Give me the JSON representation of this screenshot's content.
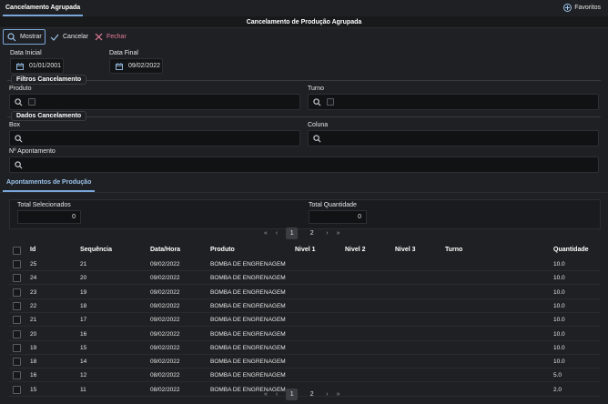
{
  "tab": {
    "label": "Cancelamento Agrupada"
  },
  "favorites": {
    "label": "Favoritos"
  },
  "page": {
    "title": "Cancelamento de Produção Agrupada"
  },
  "toolbar": {
    "mostrar": "Mostrar",
    "cancelar": "Cancelar",
    "fechar": "Fechar"
  },
  "dates": {
    "start_label": "Data Inicial",
    "start_value": "01/01/2001",
    "end_label": "Data Final",
    "end_value": "09/02/2022"
  },
  "filters": {
    "title": "Filtros Cancelamento",
    "produto_label": "Produto",
    "turno_label": "Turno"
  },
  "dados": {
    "title": "Dados Cancelamento",
    "box_label": "Box",
    "coluna_label": "Coluna",
    "apontamento_label": "Nº Apontamento"
  },
  "subtab": {
    "label": "Apontamentos de Produção"
  },
  "totals": {
    "selecionados_label": "Total Selecionados",
    "selecionados_value": "0",
    "quantidade_label": "Total Quantidade",
    "quantidade_value": "0"
  },
  "pager": {
    "first": "«",
    "prev": "‹",
    "pages": [
      "1",
      "2"
    ],
    "next": "›",
    "last": "»",
    "active_page": "1"
  },
  "table": {
    "columns": [
      "Id",
      "Sequência",
      "Data/Hora",
      "Produto",
      "Nivel 1",
      "Nivel 2",
      "Nivel 3",
      "Turno",
      "Quantidade"
    ],
    "rows": [
      [
        "25",
        "21",
        "09/02/2022",
        "BOMBA DE ENGRENAGEM",
        "",
        "",
        "",
        "",
        "10.0"
      ],
      [
        "24",
        "20",
        "09/02/2022",
        "BOMBA DE ENGRENAGEM",
        "",
        "",
        "",
        "",
        "10.0"
      ],
      [
        "23",
        "19",
        "09/02/2022",
        "BOMBA DE ENGRENAGEM",
        "",
        "",
        "",
        "",
        "10.0"
      ],
      [
        "22",
        "18",
        "09/02/2022",
        "BOMBA DE ENGRENAGEM",
        "",
        "",
        "",
        "",
        "10.0"
      ],
      [
        "21",
        "17",
        "09/02/2022",
        "BOMBA DE ENGRENAGEM",
        "",
        "",
        "",
        "",
        "10.0"
      ],
      [
        "20",
        "16",
        "09/02/2022",
        "BOMBA DE ENGRENAGEM",
        "",
        "",
        "",
        "",
        "10.0"
      ],
      [
        "19",
        "15",
        "09/02/2022",
        "BOMBA DE ENGRENAGEM",
        "",
        "",
        "",
        "",
        "10.0"
      ],
      [
        "18",
        "14",
        "09/02/2022",
        "BOMBA DE ENGRENAGEM",
        "",
        "",
        "",
        "",
        "10.0"
      ],
      [
        "16",
        "12",
        "08/02/2022",
        "BOMBA DE ENGRENAGEM",
        "",
        "",
        "",
        "",
        "5.0"
      ],
      [
        "15",
        "11",
        "08/02/2022",
        "BOMBA DE ENGRENAGEM",
        "",
        "",
        "",
        "",
        "2.0"
      ]
    ]
  },
  "colors": {
    "accent": "#7aa7d9",
    "danger": "#e57d9b",
    "background": "#1f2023"
  }
}
